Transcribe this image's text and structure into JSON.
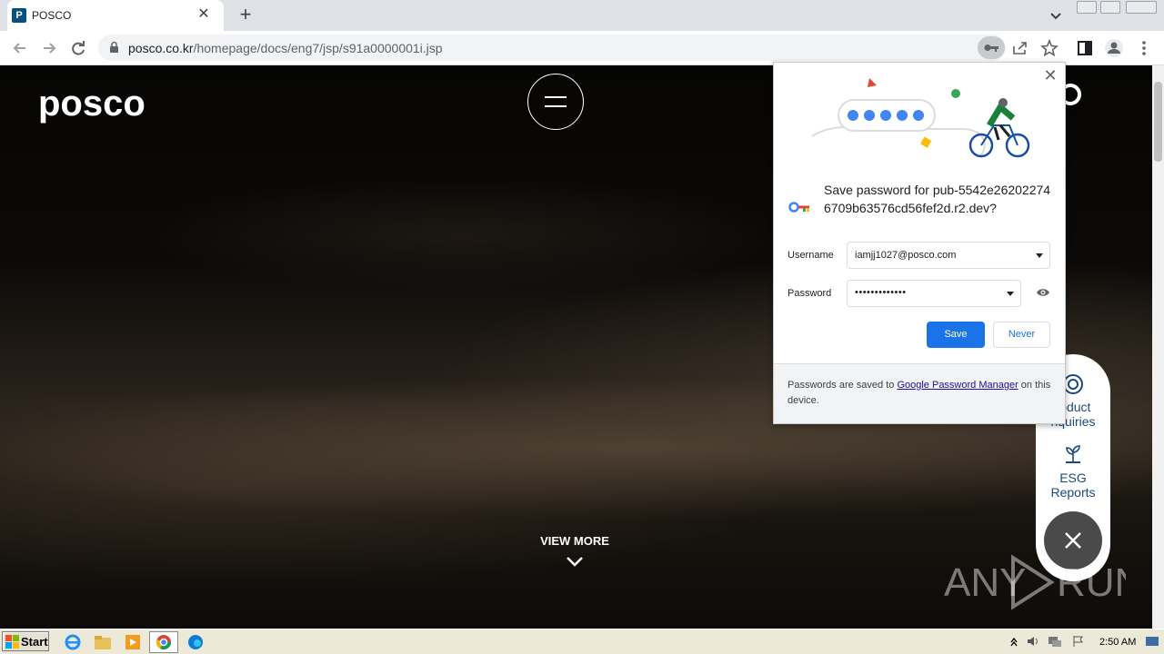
{
  "browser": {
    "tab": {
      "title": "POSCO",
      "favicon_letter": "P",
      "close_glyph": "✕"
    },
    "new_tab_glyph": "+",
    "url": {
      "host": "posco.co.kr",
      "path": "/homepage/docs/eng7/jsp/s91a0000001i.jsp"
    },
    "toolbar_icons": [
      "back-icon",
      "forward-icon",
      "reload-icon",
      "key-icon",
      "share-icon",
      "star-icon",
      "sidepanel-icon",
      "profile-icon",
      "kebab-menu-icon"
    ]
  },
  "page": {
    "logo": "posco",
    "view_more": "VIEW MORE",
    "side_panel": {
      "product_inquiries": "roduct\nnquiries",
      "esg_reports_line1": "ESG",
      "esg_reports_line2": "Reports"
    },
    "watermark": "ANY RUN"
  },
  "password_bubble": {
    "title": "Save password for pub-5542e262022746709b63576cd56fef2d.r2.dev?",
    "username_label": "Username",
    "username_value": "iamjj1027@posco.com",
    "password_label": "Password",
    "password_value": "•••••••••••••",
    "save_label": "Save",
    "never_label": "Never",
    "footer_prefix": "Passwords are saved to ",
    "footer_link": "Google Password Manager",
    "footer_suffix": " on this device.",
    "close_glyph": "✕"
  },
  "taskbar": {
    "start_label": "Start",
    "clock": "2:50 AM"
  },
  "colors": {
    "accent": "#1a73e8",
    "posco_blue": "#05507d"
  }
}
